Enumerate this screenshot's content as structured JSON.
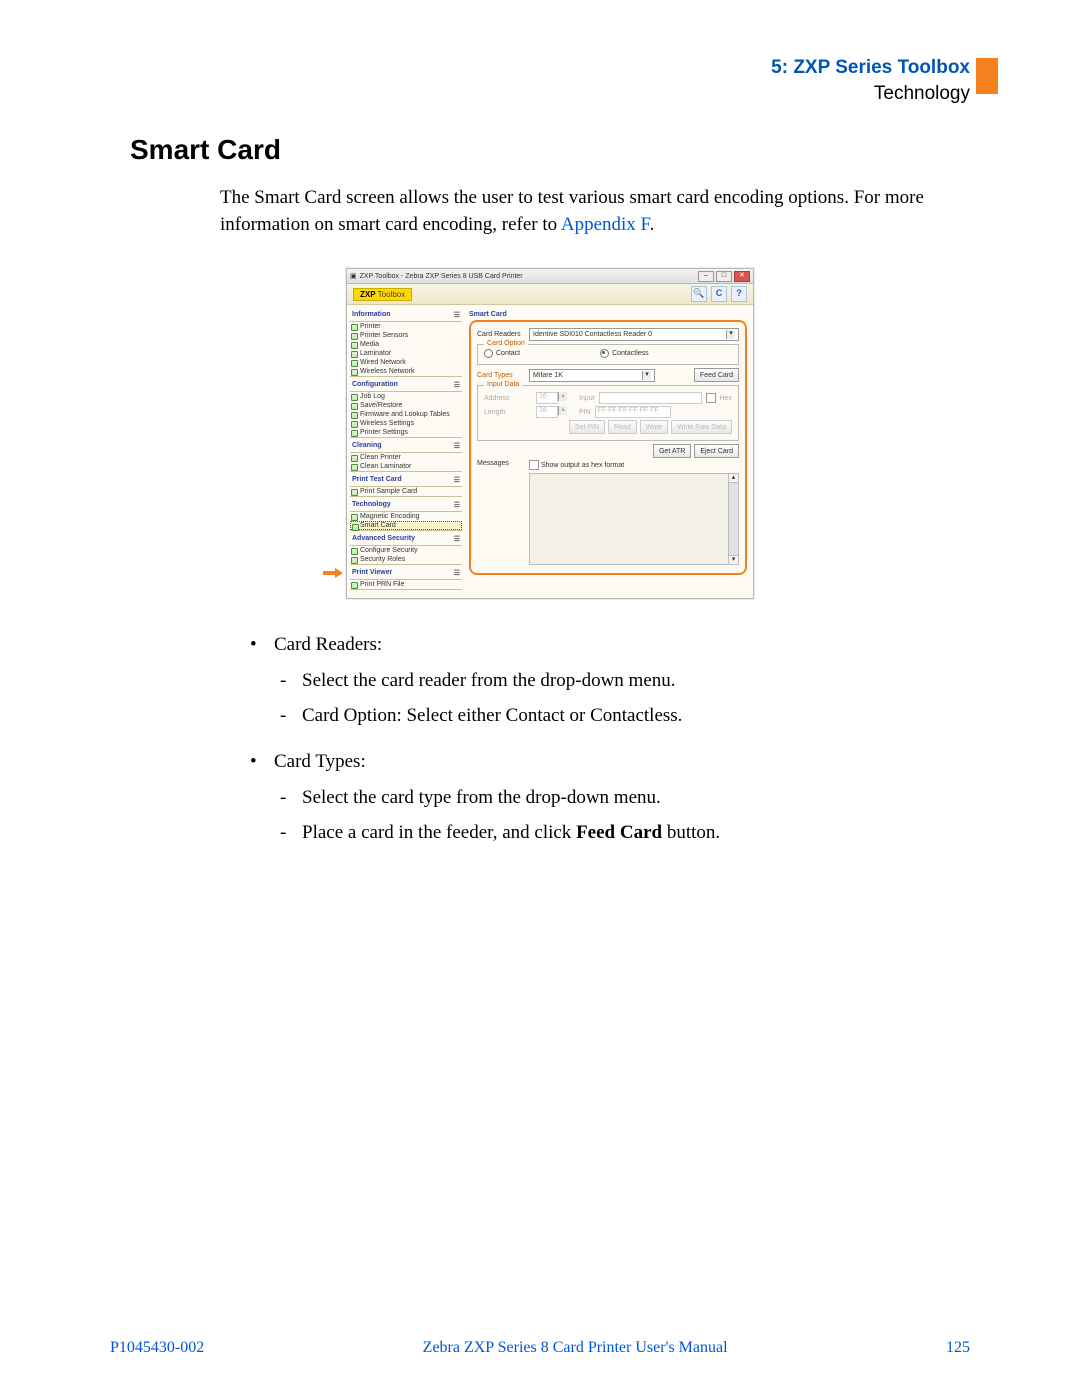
{
  "header": {
    "chapter": "5: ZXP Series Toolbox",
    "subsection": "Technology"
  },
  "section_title": "Smart Card",
  "intro": {
    "text_before": "The Smart Card screen allows the user to test various smart card encoding options. For more information on smart card encoding, refer to ",
    "link": "Appendix F",
    "text_after": "."
  },
  "app": {
    "window_title": "ZXP Toolbox - Zebra ZXP Series 8 USB Card Printer",
    "brand_bold": "ZXP",
    "brand_rest": "Toolbox",
    "toolbar_icons": {
      "search": "🔍",
      "refresh": "C",
      "help": "?"
    },
    "sidebar": {
      "groups": [
        {
          "title": "Information",
          "items": [
            "Printer",
            "Printer Sensors",
            "Media",
            "Laminator",
            "Wired Network",
            "Wireless Network"
          ]
        },
        {
          "title": "Configuration",
          "items": [
            "Job Log",
            "Save/Restore",
            "Firmware and Lookup Tables",
            "Wireless Settings",
            "Printer Settings"
          ]
        },
        {
          "title": "Cleaning",
          "items": [
            "Clean Printer",
            "Clean Laminator"
          ]
        },
        {
          "title": "Print Test Card",
          "items": [
            "Print Sample Card"
          ]
        },
        {
          "title": "Technology",
          "items": [
            "Magnetic Encoding",
            "Smart Card"
          ],
          "selected_index": 1
        },
        {
          "title": "Advanced Security",
          "items": [
            "Configure Security",
            "Security Roles"
          ]
        },
        {
          "title": "Print Viewer",
          "items": [
            "Print PRN File"
          ]
        }
      ]
    },
    "main": {
      "title": "Smart Card",
      "card_readers_label": "Card Readers",
      "card_readers_value": "Identive SDI010 Contactless Reader 0",
      "card_option_legend": "Card Option",
      "contact_label": "Contact",
      "contactless_label": "Contactless",
      "card_types_label": "Card Types",
      "card_types_value": "Mifare 1K",
      "feed_card_btn": "Feed Card",
      "input_data_legend": "Input Data",
      "address_label": "Address",
      "address_value": "16",
      "input_label": "Input",
      "hex_label": "Hex",
      "length_label": "Length",
      "length_value": "16",
      "pin_label": "PIN",
      "pin_value": "FF FF FF FF FF FF",
      "set_pin_btn": "Set PIN",
      "read_btn": "Read",
      "write_btn": "Write",
      "write_raw_btn": "Write Raw Data",
      "get_atr_btn": "Get ATR",
      "eject_btn": "Eject Card",
      "messages_label": "Messages",
      "hex_output_label": "Show output as hex format"
    }
  },
  "bullets": {
    "card_readers_head": "Card Readers:",
    "card_readers_items": [
      "Select the card reader from the drop-down menu.",
      "Card Option: Select either Contact or Contactless."
    ],
    "card_types_head": "Card Types:",
    "card_types_items": [
      "Select the card type from the drop-down menu.",
      {
        "pre": "Place a card in the feeder, and click ",
        "bold": "Feed Card",
        "post": " button."
      }
    ]
  },
  "footer": {
    "left": "P1045430-002",
    "center": "Zebra ZXP Series 8 Card Printer User's Manual",
    "right": "125"
  }
}
